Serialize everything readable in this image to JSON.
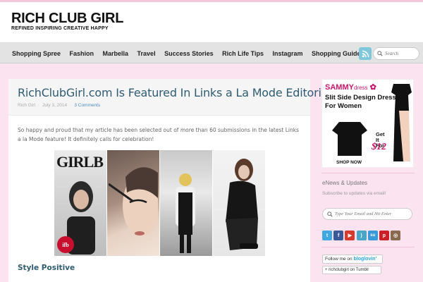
{
  "header": {
    "site_title": "RICH CLUB GIRL",
    "tagline": "REFINED INSPIRING CREATIVE HAPPY"
  },
  "nav": {
    "items": [
      {
        "label": "Shopping Spree"
      },
      {
        "label": "Fashion"
      },
      {
        "label": "Marbella"
      },
      {
        "label": "Travel"
      },
      {
        "label": "Success Stories"
      },
      {
        "label": "Rich Life Tips"
      },
      {
        "label": "Instagram"
      },
      {
        "label": "Shopping Guide"
      }
    ],
    "search_placeholder": "Search"
  },
  "post": {
    "title": "RichClubGirl.com Is Featured In Links a La Mode Editorial",
    "author": "Rich Girl",
    "date": "July 3, 2014",
    "comments": "3 Comments",
    "body_text": "So happy and proud that my article has been selected out of more than 60 submissions in the latest Links a la Mode feature! It definitely calls for celebration!",
    "image_text_girlb": "GIRLB",
    "image_text_ifb": "ifb",
    "section_heading": "Style Positive"
  },
  "sidebar": {
    "ad": {
      "brand": "SAMMY",
      "brand_suffix": "dress",
      "line1": "Slit Side Design Dress",
      "line2": "For Women",
      "get_line1": "Get",
      "get_line2": "It",
      "get_line3": "For",
      "price": "$12",
      "cta": "SHOP NOW"
    },
    "newsletter_title": "eNews & Updates",
    "newsletter_sub": "Subscribe to updates via email!",
    "email_placeholder": "Type Your Email and Hit Enter",
    "social_icons": [
      {
        "icon": "twitter-icon",
        "glyph": "t",
        "color": "#3ea9e0"
      },
      {
        "icon": "facebook-icon",
        "glyph": "f",
        "color": "#3b5998"
      },
      {
        "icon": "youtube-icon",
        "glyph": "▶",
        "color": "#d43a2d"
      },
      {
        "icon": "rss-icon",
        "glyph": ")",
        "color": "#4aa6c7"
      },
      {
        "icon": "stumbleupon-icon",
        "glyph": "su",
        "color": "#3a9ad9"
      },
      {
        "icon": "pinterest-icon",
        "glyph": "p",
        "color": "#cb2027"
      },
      {
        "icon": "instagram-icon",
        "glyph": "◎",
        "color": "#8a6a4f"
      }
    ],
    "bloglovin_prefix": "Follow me on",
    "bloglovin_brand": "bloglovin'",
    "tumblr_label": "+ richclubgirl on Tumblr"
  }
}
